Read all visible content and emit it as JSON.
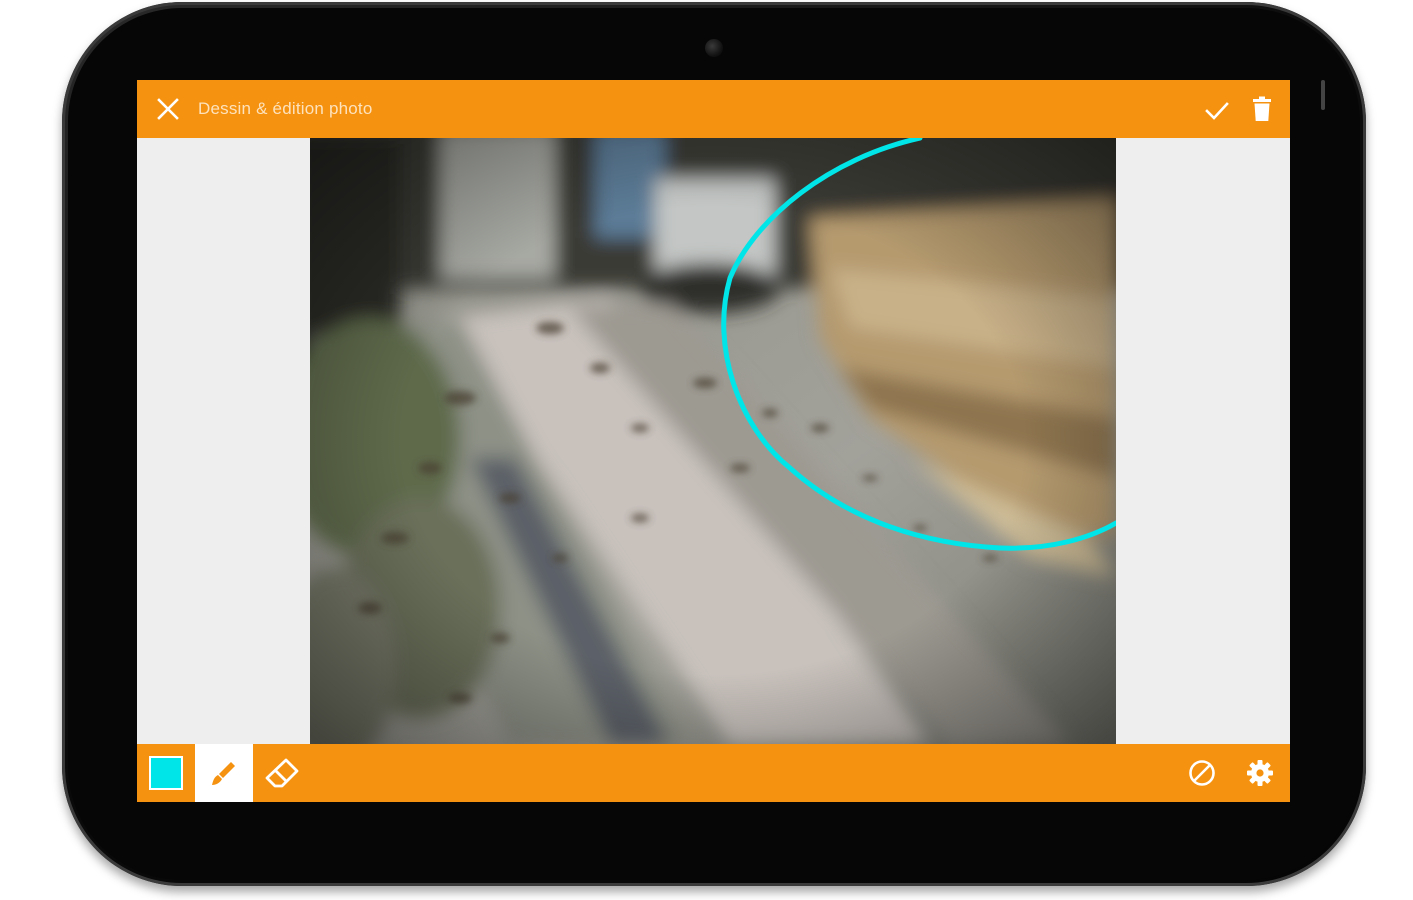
{
  "app": {
    "title": "Dessin & édition photo"
  },
  "toolbar_bottom": {
    "selected_tool": "brush",
    "current_color": "#00e5e8"
  },
  "colors": {
    "accent": "#f5920f",
    "title_text": "#fde2bd",
    "stroke": "#00e5e8"
  },
  "icons": {
    "close": "close-icon",
    "confirm": "check-icon",
    "delete": "trash-icon",
    "color": "color-swatch",
    "brush": "brush-icon",
    "eraser": "eraser-icon",
    "clear": "clear-icon",
    "settings": "gear-icon"
  }
}
